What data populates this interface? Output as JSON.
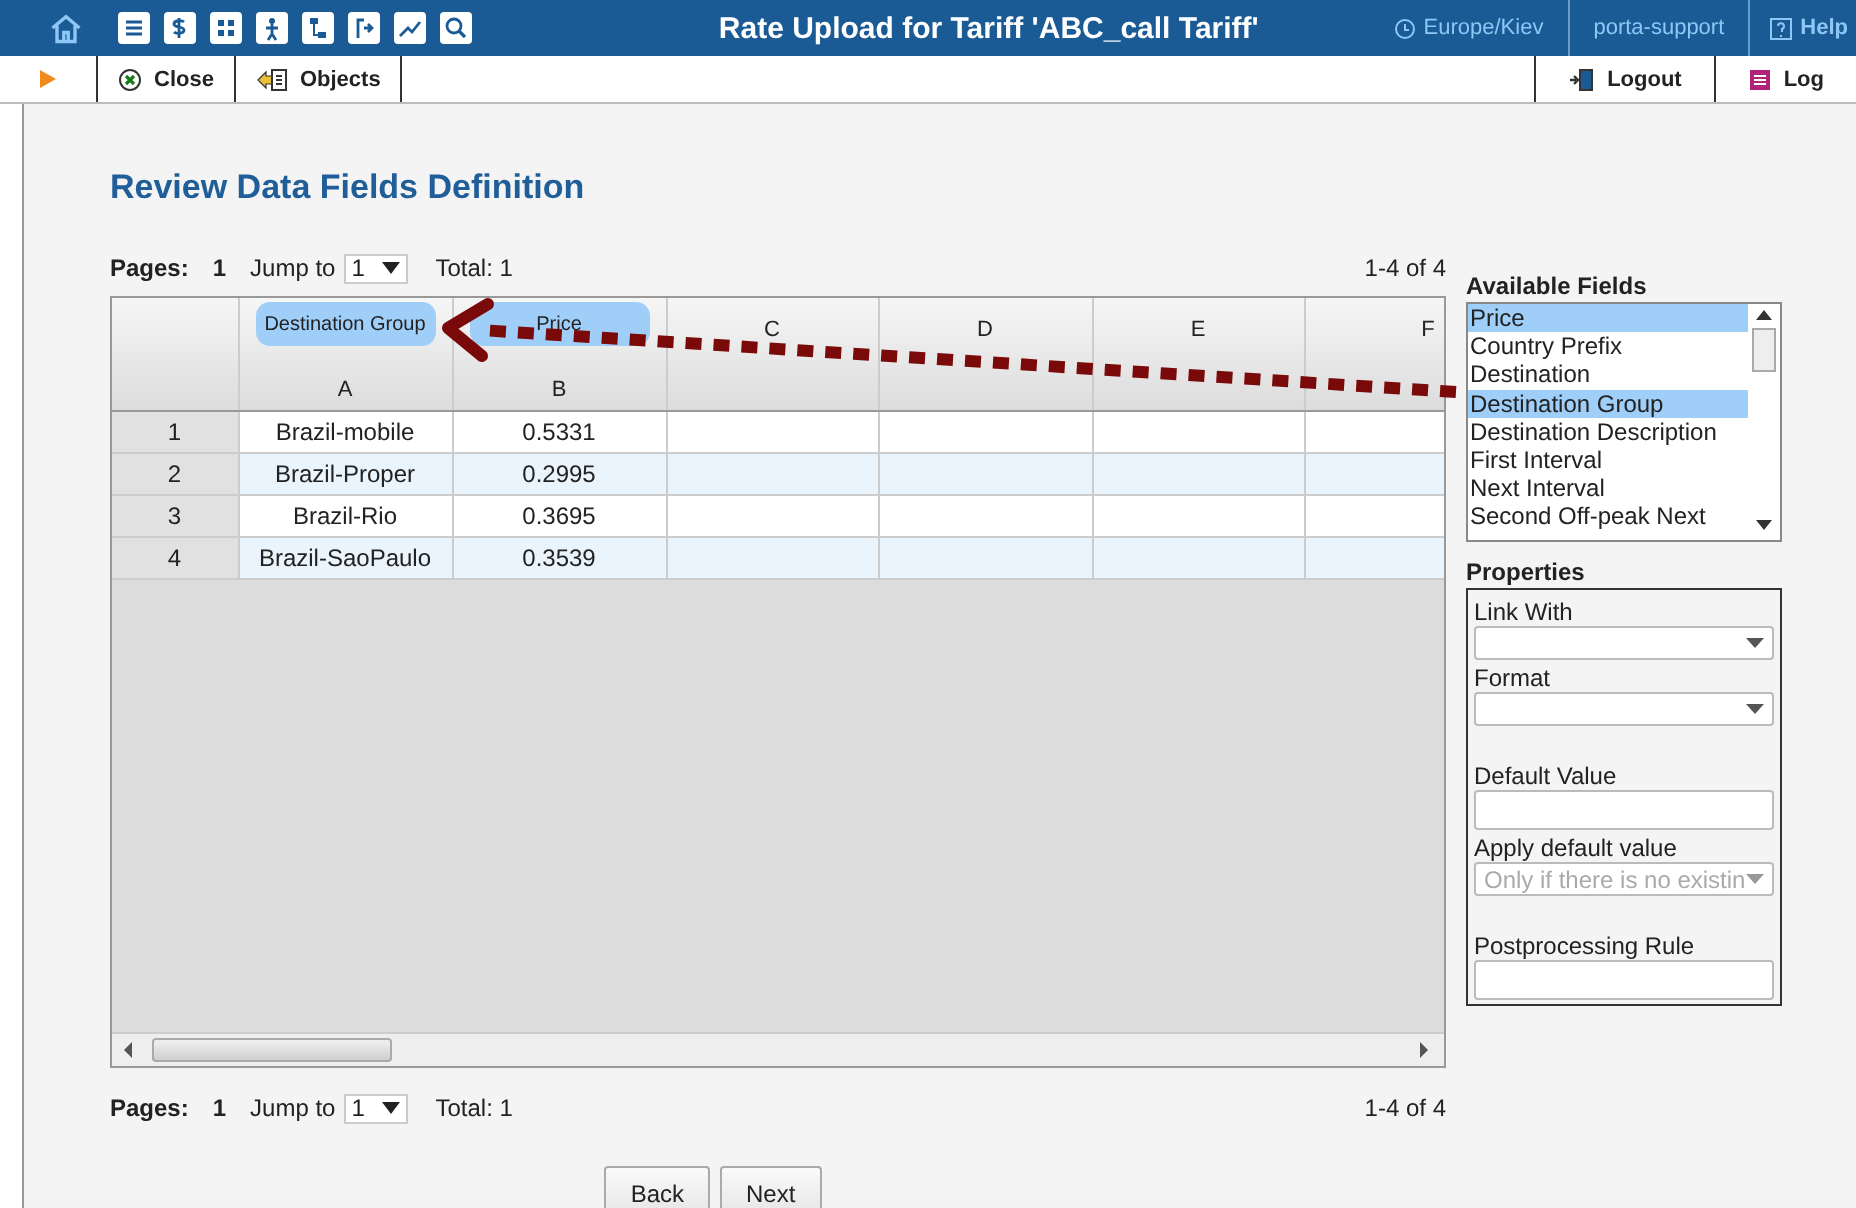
{
  "window": {
    "title": "Rate Upload for Tariff 'ABC_call Tariff'"
  },
  "top_bar": {
    "timezone": "Europe/Kiev",
    "user": "porta-support",
    "help": "Help"
  },
  "toolbar": {
    "left": [
      {
        "label": "Close",
        "kind": "close"
      },
      {
        "label": "Objects",
        "kind": "objects"
      }
    ],
    "right": [
      {
        "label": "Logout",
        "kind": "logout"
      },
      {
        "label": "Log",
        "kind": "log"
      }
    ]
  },
  "heading": "Review Data Fields Definition",
  "pager_top": {
    "pages_label": "Pages:",
    "page": "1",
    "jump_label": "Jump to",
    "jump_value": "1",
    "total": "Total: 1",
    "range": "1-4 of 4"
  },
  "grid": {
    "columns": [
      {
        "letter": "A",
        "mapped": "Destination Group"
      },
      {
        "letter": "B",
        "mapped": "Price"
      },
      {
        "letter": "C"
      },
      {
        "letter": "D"
      },
      {
        "letter": "E"
      },
      {
        "letter": "F"
      }
    ],
    "rows": [
      {
        "number": "1",
        "cells": [
          "Brazil-mobile",
          "0.5331"
        ]
      },
      {
        "number": "2",
        "cells": [
          "Brazil-Proper",
          "0.2995"
        ]
      },
      {
        "number": "3",
        "cells": [
          "Brazil-Rio",
          "0.3695"
        ]
      },
      {
        "number": "4",
        "cells": [
          "Brazil-SaoPaulo",
          "0.3539"
        ]
      }
    ]
  },
  "pager_bottom": {
    "pages_label": "Pages:",
    "page": "1",
    "jump_label": "Jump to",
    "jump_value": "1",
    "total": "Total: 1",
    "range": "1-4 of 4"
  },
  "available_fields": {
    "label": "Available Fields",
    "items": [
      {
        "label": "Price",
        "selected": true
      },
      {
        "label": "Country Prefix",
        "selected": false
      },
      {
        "label": "Destination",
        "selected": false
      },
      {
        "label": "Destination Group",
        "selected": true
      },
      {
        "label": "Destination Description",
        "selected": false
      },
      {
        "label": "First Interval",
        "selected": false
      },
      {
        "label": "Next Interval",
        "selected": false
      },
      {
        "label": "Second Off-peak Next",
        "selected": false
      }
    ]
  },
  "properties": {
    "label": "Properties",
    "fields": [
      {
        "label": "Link With",
        "kind": "select",
        "disabled": false
      },
      {
        "label": "Format",
        "kind": "select",
        "disabled": false
      },
      {
        "label": "Default Value",
        "kind": "text"
      },
      {
        "label": "Apply default value",
        "kind": "select",
        "value": "Only if there is no existin",
        "disabled": true
      },
      {
        "label": "Postprocessing Rule",
        "kind": "text"
      }
    ]
  },
  "buttons": [
    "Back",
    "Next"
  ]
}
